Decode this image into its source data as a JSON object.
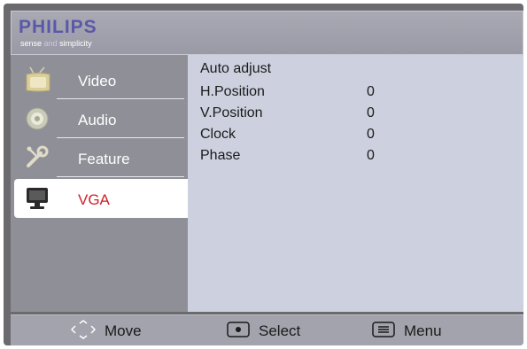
{
  "brand": {
    "name": "PHILIPS",
    "tagline_pre": "sense ",
    "tagline_and": "and",
    "tagline_post": " simplicity"
  },
  "menu": {
    "items": [
      {
        "label": "Video",
        "icon": "tv-icon"
      },
      {
        "label": "Audio",
        "icon": "speaker-icon"
      },
      {
        "label": "Feature",
        "icon": "wrench-icon"
      },
      {
        "label": "VGA",
        "icon": "monitor-icon",
        "active": true
      }
    ]
  },
  "content": {
    "rows": [
      {
        "label": "Auto adjust",
        "value": ""
      },
      {
        "label": "H.Position",
        "value": "0"
      },
      {
        "label": "V.Position",
        "value": "0"
      },
      {
        "label": "Clock",
        "value": "0"
      },
      {
        "label": "Phase",
        "value": "0"
      }
    ]
  },
  "footer": {
    "move_label": "Move",
    "select_label": "Select",
    "menu_label": "Menu"
  },
  "colors": {
    "accent": "#d0202a",
    "brand": "#5a58a8"
  }
}
